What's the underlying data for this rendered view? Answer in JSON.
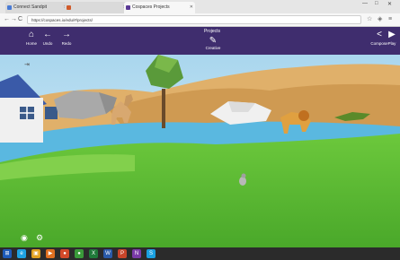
{
  "browser": {
    "tabs": [
      {
        "label": "Connect Sandpit",
        "color": "#4a7bd4"
      },
      {
        "label": "",
        "color": "#d05a2a"
      },
      {
        "label": "Cospaces Projects",
        "color": "#5a3a96"
      }
    ],
    "window_controls": {
      "minimize": "—",
      "maximize": "□",
      "close": "✕"
    },
    "url": "https://cospaces.io/edu/#/projects/",
    "nav": {
      "back": "←",
      "forward": "→",
      "reload": "C",
      "home": "⌂"
    }
  },
  "app": {
    "project_title": "Projects",
    "toolbar": {
      "home": {
        "icon": "⌂",
        "label": "Home"
      },
      "undo": {
        "icon": "←",
        "label": "Undo"
      },
      "redo": {
        "icon": "→",
        "label": "Redo"
      },
      "create": {
        "icon": "✎",
        "label": "Creative"
      },
      "share": {
        "icon": "<",
        "label": "Compose"
      },
      "play": {
        "icon": "▶",
        "label": "Play"
      }
    },
    "scene_buttons": {
      "camera": "◉",
      "settings": "⚙"
    },
    "ruler_icon": "⇥"
  },
  "taskbar": {
    "clock_time": "",
    "items": [
      {
        "icon": "⊞",
        "color": "#1e5bb8"
      },
      {
        "icon": "e",
        "color": "#1ea1e0"
      },
      {
        "icon": "▣",
        "color": "#e0a020"
      },
      {
        "icon": "▶",
        "color": "#e07020"
      },
      {
        "icon": "●",
        "color": "#d44a2a"
      },
      {
        "icon": "●",
        "color": "#3a9a3a"
      },
      {
        "icon": "X",
        "color": "#1f7a3a"
      },
      {
        "icon": "W",
        "color": "#2a5aa8"
      },
      {
        "icon": "P",
        "color": "#c8452a"
      },
      {
        "icon": "N",
        "color": "#7a3aa8"
      },
      {
        "icon": "S",
        "color": "#1aa0e0"
      }
    ]
  }
}
